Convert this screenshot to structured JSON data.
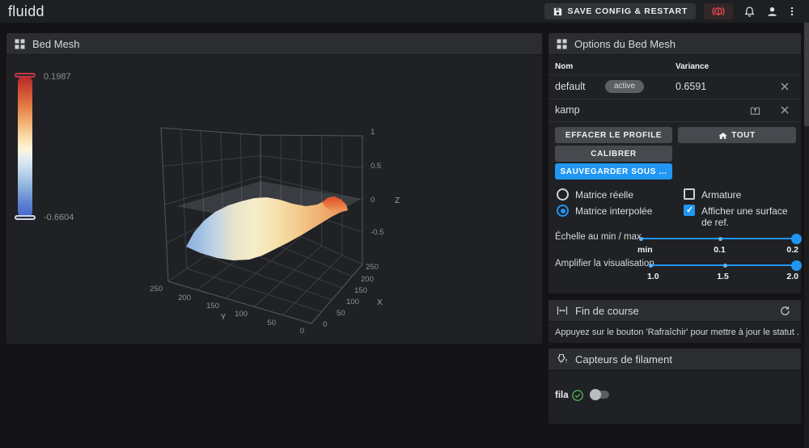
{
  "colors": {
    "accent_blue": "#2196f3",
    "estop_red": "#e5484d",
    "success_green": "#4caf50"
  },
  "app_bar": {
    "logo": "fluidd",
    "save_button": "SAVE CONFIG & RESTART"
  },
  "bed_mesh_panel": {
    "title": "Bed Mesh",
    "colorbar": {
      "max_label": "0.1987",
      "min_label": "-0.6604"
    },
    "chart": {
      "type": "surface_3d",
      "x_title": "X",
      "y_title": "Y",
      "z_title": "Z",
      "x_ticks": [
        "0",
        "50",
        "100",
        "150",
        "200",
        "250"
      ],
      "y_ticks": [
        "0",
        "50",
        "100",
        "150",
        "200",
        "250"
      ],
      "z_ticks": [
        "1",
        "0.5",
        "0",
        "-0.5"
      ],
      "z_range": [
        -1,
        1
      ],
      "surface_min": -0.6604,
      "surface_max": 0.1987,
      "has_reference_plane": true
    }
  },
  "options_panel": {
    "title": "Options du Bed Mesh",
    "table": {
      "col_name": "Nom",
      "col_variance": "Variance",
      "rows": [
        {
          "name": "default",
          "badge": "active",
          "variance": "0.6591"
        },
        {
          "name": "kamp",
          "badge": "",
          "variance": ""
        }
      ]
    },
    "clear_profile_button": "EFFACER LE PROFILE",
    "all_button": "TOUT",
    "calibrate_button": "CALIBRER",
    "save_as_button": "SAUVEGARDER SOUS ...",
    "radio_actual": "Matrice réelle",
    "radio_interpolated": "Matrice interpolée",
    "checkbox_wireframe": "Armature",
    "checkbox_ref_surface": "Afficher une surface de ref.",
    "scale_slider": {
      "label": "Échelle au min / max",
      "ticks": [
        "min",
        "0.1",
        "0.2"
      ]
    },
    "boost_slider": {
      "label": "Amplifier la visualisation",
      "ticks": [
        "1.0",
        "1.5",
        "2.0"
      ]
    }
  },
  "endstops_panel": {
    "title": "Fin de course",
    "message": "Appuyez sur le bouton 'Rafraîchir' pour mettre à jour le statut ."
  },
  "filament_panel": {
    "title": "Capteurs de filament",
    "sensor_name": "fila"
  }
}
